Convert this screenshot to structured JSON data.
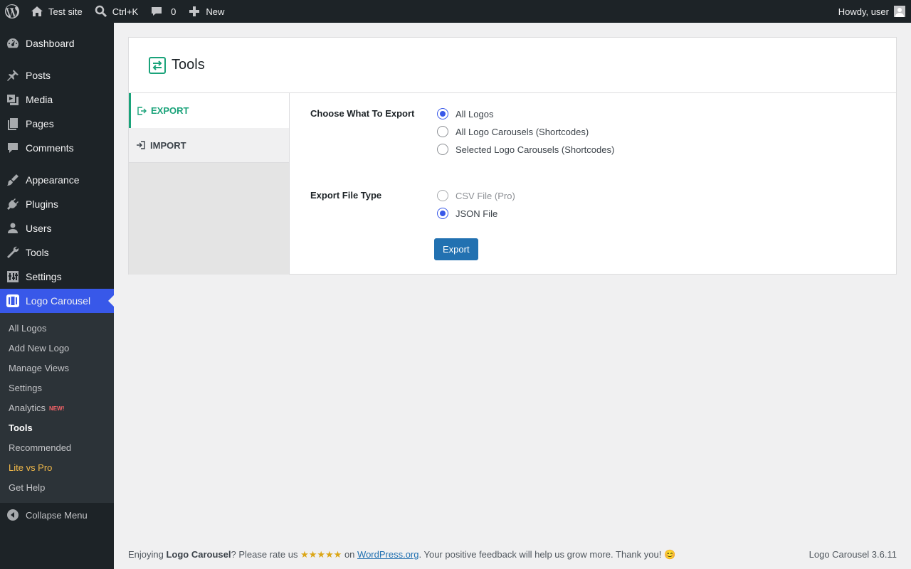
{
  "adminbar": {
    "site_name": "Test site",
    "search_shortcut": "Ctrl+K",
    "comments_count": "0",
    "new_label": "New",
    "howdy": "Howdy, user"
  },
  "sidebar": {
    "items": [
      {
        "label": "Dashboard",
        "icon": "dashboard-icon"
      },
      {
        "label": "Posts",
        "icon": "pin-icon"
      },
      {
        "label": "Media",
        "icon": "media-icon"
      },
      {
        "label": "Pages",
        "icon": "pages-icon"
      },
      {
        "label": "Comments",
        "icon": "comment-icon"
      },
      {
        "label": "Appearance",
        "icon": "brush-icon"
      },
      {
        "label": "Plugins",
        "icon": "plug-icon"
      },
      {
        "label": "Users",
        "icon": "user-icon"
      },
      {
        "label": "Tools",
        "icon": "wrench-icon"
      },
      {
        "label": "Settings",
        "icon": "settings-icon"
      },
      {
        "label": "Logo Carousel",
        "icon": "carousel-icon"
      }
    ],
    "submenu": [
      {
        "label": "All Logos"
      },
      {
        "label": "Add New Logo"
      },
      {
        "label": "Manage Views"
      },
      {
        "label": "Settings"
      },
      {
        "label": "Analytics",
        "badge": "NEW!"
      },
      {
        "label": "Tools"
      },
      {
        "label": "Recommended"
      },
      {
        "label": "Lite vs Pro"
      },
      {
        "label": "Get Help"
      }
    ],
    "collapse_label": "Collapse Menu"
  },
  "page": {
    "title": "Tools",
    "tabs": [
      {
        "label": "EXPORT"
      },
      {
        "label": "IMPORT"
      }
    ],
    "export_what": {
      "label": "Choose What To Export",
      "options": [
        "All Logos",
        "All Logo Carousels (Shortcodes)",
        "Selected Logo Carousels (Shortcodes)"
      ],
      "selected": "All Logos"
    },
    "file_type": {
      "label": "Export File Type",
      "options": [
        "CSV File (Pro)",
        "JSON File"
      ],
      "selected": "JSON File"
    },
    "export_button": "Export"
  },
  "footer": {
    "enjoying": "Enjoying ",
    "plugin_name": "Logo Carousel",
    "rate_text": "? Please rate us ",
    "stars": "★★★★★",
    "on": " on ",
    "link": "WordPress.org",
    "thanks": ". Your positive feedback will help us grow more. Thank you! 😊",
    "version": "Logo Carousel 3.6.11"
  },
  "colors": {
    "adminbar_bg": "#1d2327",
    "accent_blue": "#3858e9",
    "button_blue": "#2271b1",
    "tab_green": "#1aa37a"
  }
}
